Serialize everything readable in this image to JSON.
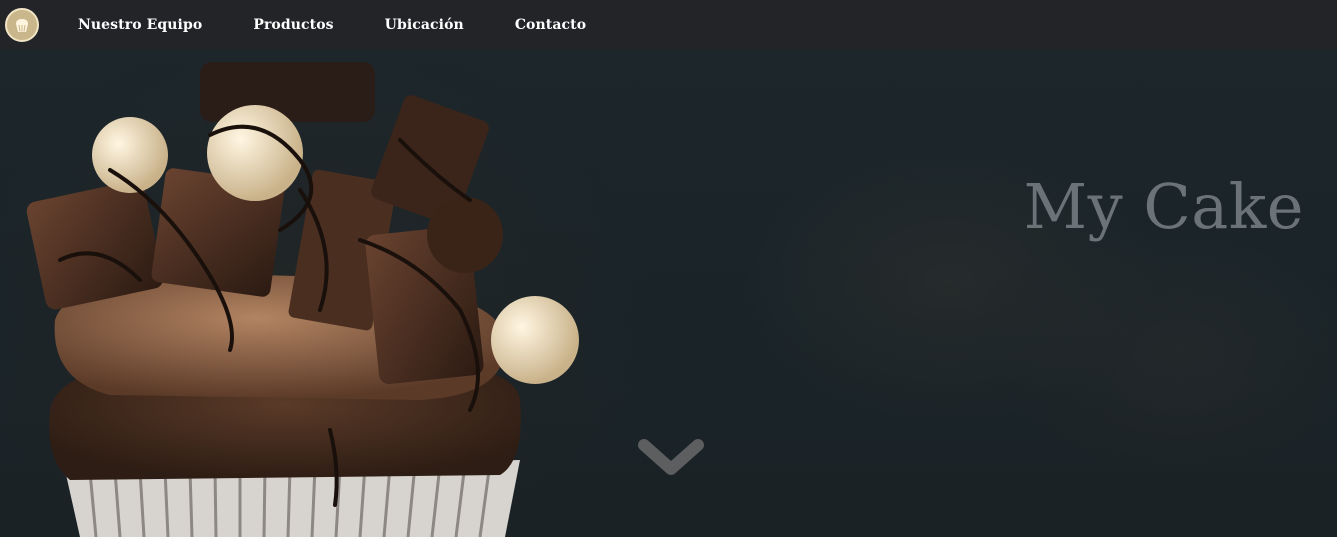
{
  "nav": {
    "logo_icon": "cupcake-icon",
    "items": [
      {
        "label": "Nuestro Equipo"
      },
      {
        "label": "Productos"
      },
      {
        "label": "Ubicación"
      },
      {
        "label": "Contacto"
      }
    ]
  },
  "hero": {
    "title": "My Cake",
    "image": "chocolate-cupcake-photo",
    "scroll_icon": "chevron-down-icon"
  },
  "colors": {
    "navbar_bg": "#222428",
    "hero_bg": "#1a2428",
    "title": "#6c7378",
    "logo": "#c9b68a"
  }
}
